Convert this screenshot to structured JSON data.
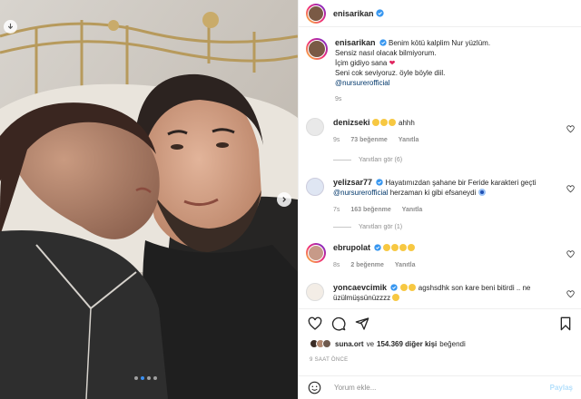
{
  "post": {
    "author": "enisarikan",
    "caption_lines": [
      "Benim kötü kalplim Nur yüzlüm.",
      "Sensiz nasıl olacak bilmiyorum.",
      "İçim gidiyo sana",
      "Seni cok seviyoruz. öyle böyle diil."
    ],
    "caption_mention": "@nursurerofficial",
    "caption_time": "9s"
  },
  "comments": [
    {
      "user": "denizseki",
      "text": "ahhh",
      "time": "9s",
      "likes": "73 beğenme",
      "reply": "Yanıtla",
      "view_replies": "Yanıtları gör (6)"
    },
    {
      "user": "yelizsar77",
      "text_before": "Hayatımızdan şahane bir Feride karakteri geçti",
      "mention": "@nursurerofficial",
      "text_after": "herzaman ki gibi efsaneydi",
      "time": "7s",
      "likes": "163 beğenme",
      "reply": "Yanıtla",
      "view_replies": "Yanıtları gör (1)"
    },
    {
      "user": "ebrupolat",
      "time": "8s",
      "likes": "2 beğenme",
      "reply": "Yanıtla"
    },
    {
      "user": "yoncaevcimik",
      "text": "agshsdhk son kare beni bitirdi .. ne üzülmüşsünüzzzz"
    }
  ],
  "likes": {
    "user": "suna.ort",
    "connector": "ve",
    "others": "154.369 diğer kişi",
    "suffix": "beğendi"
  },
  "timestamp": "9 SAAT ÖNCE",
  "comment_box": {
    "placeholder": "Yorum ekle...",
    "post_label": "Paylaş"
  },
  "colors": {
    "verified": "#3897f0",
    "link": "#00376b",
    "muted": "#8e8e8e",
    "heart": "#e0245e"
  },
  "icons": [
    "download-icon",
    "chevron-right-icon",
    "heart-icon",
    "comment-icon",
    "share-icon",
    "bookmark-icon",
    "smiley-icon",
    "verified-icon"
  ],
  "carousel": {
    "slides": 4,
    "active": 1
  }
}
